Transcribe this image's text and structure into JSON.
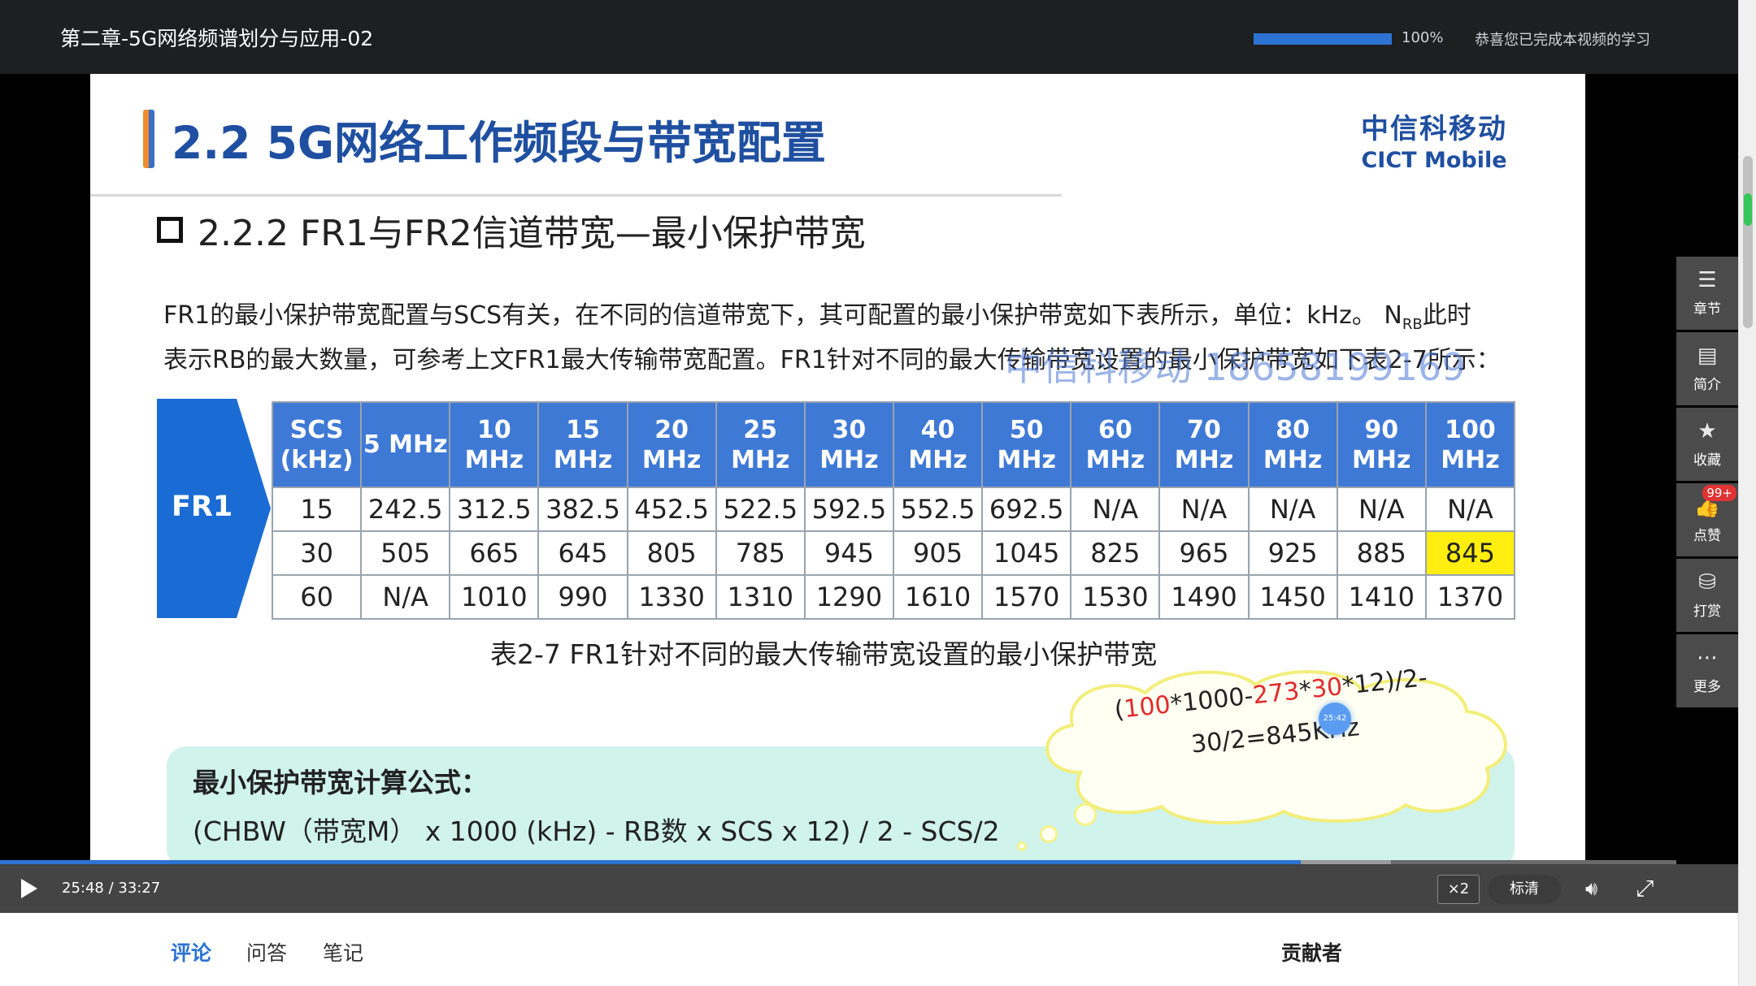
{
  "header": {
    "video_title": "第二章-5G网络频谱划分与应用-02",
    "watch_progress_percent": 100,
    "progress_label": "100%",
    "completion_message": "恭喜您已完成本视频的学习"
  },
  "slide": {
    "heading": "2.2 5G网络工作频段与带宽配置",
    "brand_cn": "中信科移动",
    "brand_en": "CICT Mobile",
    "subheading": "2.2.2 FR1与FR2信道带宽—最小保护带宽",
    "paragraph_line1_a": "FR1的最小保护带宽配置与SCS有关，在不同的信道带宽下，其可配置的最小保护带宽如下表所示，单位：kHz。 N",
    "paragraph_line1_sub": "RB",
    "paragraph_line1_b": "此时",
    "paragraph_line2": "表示RB的最大数量，可参考上文FR1最大传输带宽配置。FR1针对不同的最大传输带宽设置的最小保护带宽如下表2-7所示：",
    "watermark": "中信科移动 18658199169",
    "fr1_label": "FR1",
    "table": {
      "headers": [
        "SCS\n(kHz)",
        "5 MHz",
        "10\nMHz",
        "15\nMHz",
        "20\nMHz",
        "25\nMHz",
        "30\nMHz",
        "40\nMHz",
        "50\nMHz",
        "60\nMHz",
        "70\nMHz",
        "80\nMHz",
        "90\nMHz",
        "100\nMHz"
      ],
      "rows": [
        [
          "15",
          "242.5",
          "312.5",
          "382.5",
          "452.5",
          "522.5",
          "592.5",
          "552.5",
          "692.5",
          "N/A",
          "N/A",
          "N/A",
          "N/A",
          "N/A"
        ],
        [
          "30",
          "505",
          "665",
          "645",
          "805",
          "785",
          "945",
          "905",
          "1045",
          "825",
          "965",
          "925",
          "885",
          "845"
        ],
        [
          "60",
          "N/A",
          "1010",
          "990",
          "1330",
          "1310",
          "1290",
          "1610",
          "1570",
          "1530",
          "1490",
          "1450",
          "1410",
          "1370"
        ]
      ],
      "highlight_color": "#ffee10"
    },
    "caption": "表2-7  FR1针对不同的最大传输带宽设置的最小保护带宽",
    "cloud_note": {
      "open_paren": "(",
      "v1": "100",
      "t1": "*1000-",
      "v2": "273",
      "t2": "*",
      "v3": "30",
      "t3": "*12)/2-",
      "line2": "30/2=845KHz"
    },
    "marker_time": "25:42",
    "formula_title": "最小保护带宽计算公式：",
    "formula": "(CHBW（带宽M） x 1000 (kHz) - RB数 x SCS x 12) / 2 - SCS/2"
  },
  "player": {
    "current_time": "25:48",
    "duration": "33:27",
    "played_fraction": 0.7758,
    "buffered_fraction": 0.83,
    "speed_label": "×2",
    "quality_label": "标清",
    "icons": {
      "play": "play-icon",
      "volume": "volume-icon",
      "fullscreen": "fullscreen-icon"
    }
  },
  "side_menu": [
    {
      "label": "章节",
      "icon": "list-icon",
      "glyph": "☰"
    },
    {
      "label": "简介",
      "icon": "document-icon",
      "glyph": "▤"
    },
    {
      "label": "收藏",
      "icon": "star-icon",
      "glyph": "★"
    },
    {
      "label": "点赞",
      "icon": "thumbs-up-icon",
      "glyph": "👍",
      "badge": "99+"
    },
    {
      "label": "打赏",
      "icon": "coins-icon",
      "glyph": "⛁"
    },
    {
      "label": "更多",
      "icon": "more-icon",
      "glyph": "⋯"
    }
  ],
  "tabs": [
    "评论",
    "问答",
    "笔记"
  ],
  "active_tab": 0,
  "contributors_label": "贡献者",
  "colors": {
    "accent_blue": "#2c73d2",
    "heading_blue": "#1f4fa0",
    "table_header": "#3f79d6",
    "fr1_arrow": "#1a6cd4",
    "formula_bg": "#d0f3ec",
    "value_red": "#e12b2b"
  }
}
